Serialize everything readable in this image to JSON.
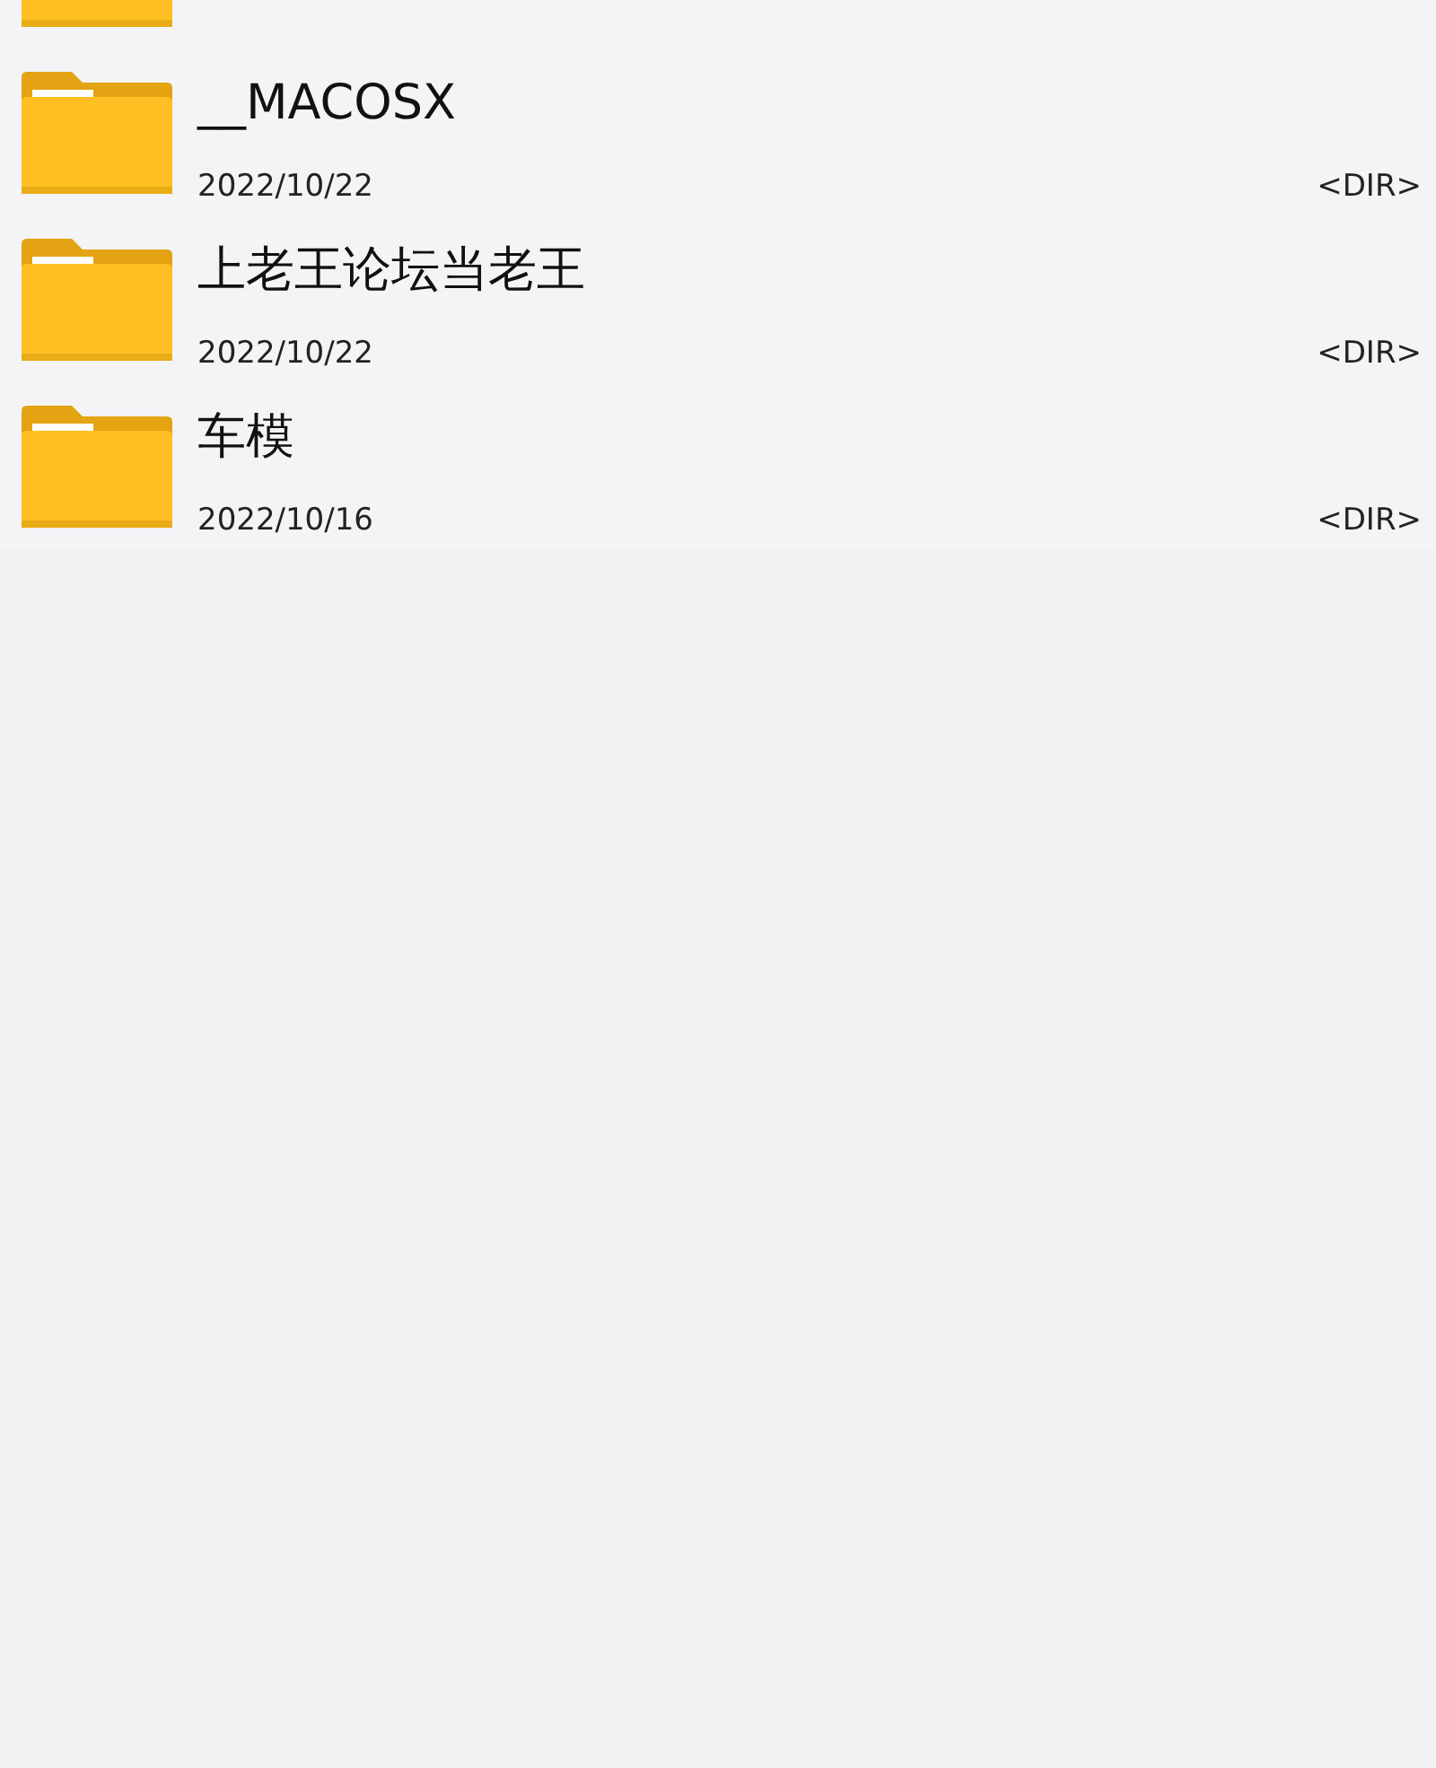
{
  "folders": [
    {
      "name": "__MACOSX",
      "date": "2022/10/22",
      "type": "<DIR>"
    },
    {
      "name": "上老王论坛当老王",
      "date": "2022/10/22",
      "type": "<DIR>"
    },
    {
      "name": "车模",
      "date": "2022/10/16",
      "type": "<DIR>"
    }
  ]
}
